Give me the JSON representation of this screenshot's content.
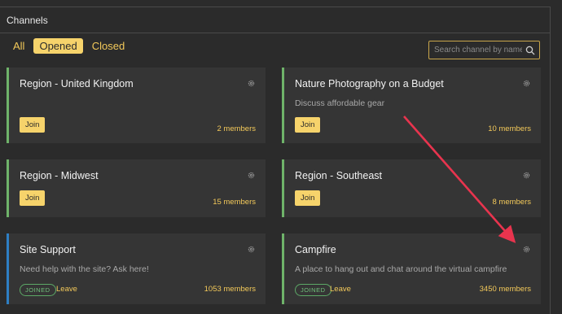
{
  "header": {
    "title": "Channels"
  },
  "filters": {
    "all": "All",
    "opened": "Opened",
    "closed": "Closed"
  },
  "search": {
    "placeholder": "Search channel by name"
  },
  "cards": [
    {
      "title": "Region - United Kingdom",
      "description": "",
      "action": "Join",
      "members": "2 members"
    },
    {
      "title": "Nature Photography on a Budget",
      "description": "Discuss affordable gear",
      "action": "Join",
      "members": "10 members"
    },
    {
      "title": "Region - Midwest",
      "description": "",
      "action": "Join",
      "members": "15 members"
    },
    {
      "title": "Region - Southeast",
      "description": "",
      "action": "Join",
      "members": "8 members"
    },
    {
      "title": "Site Support",
      "description": "Need help with the site? Ask here!",
      "badge": "JOINED",
      "action": "Leave",
      "members": "1053 members"
    },
    {
      "title": "Campfire",
      "description": "A place to hang out and chat around the virtual campfire",
      "badge": "JOINED",
      "action": "Leave",
      "members": "3450 members"
    }
  ],
  "colors": {
    "accent": "#f6d36b",
    "green_border": "#6fb36a",
    "blue_border": "#2e7fc4",
    "annotation_arrow": "#e8344e"
  },
  "icons": [
    "search-icon",
    "gear-icon"
  ]
}
